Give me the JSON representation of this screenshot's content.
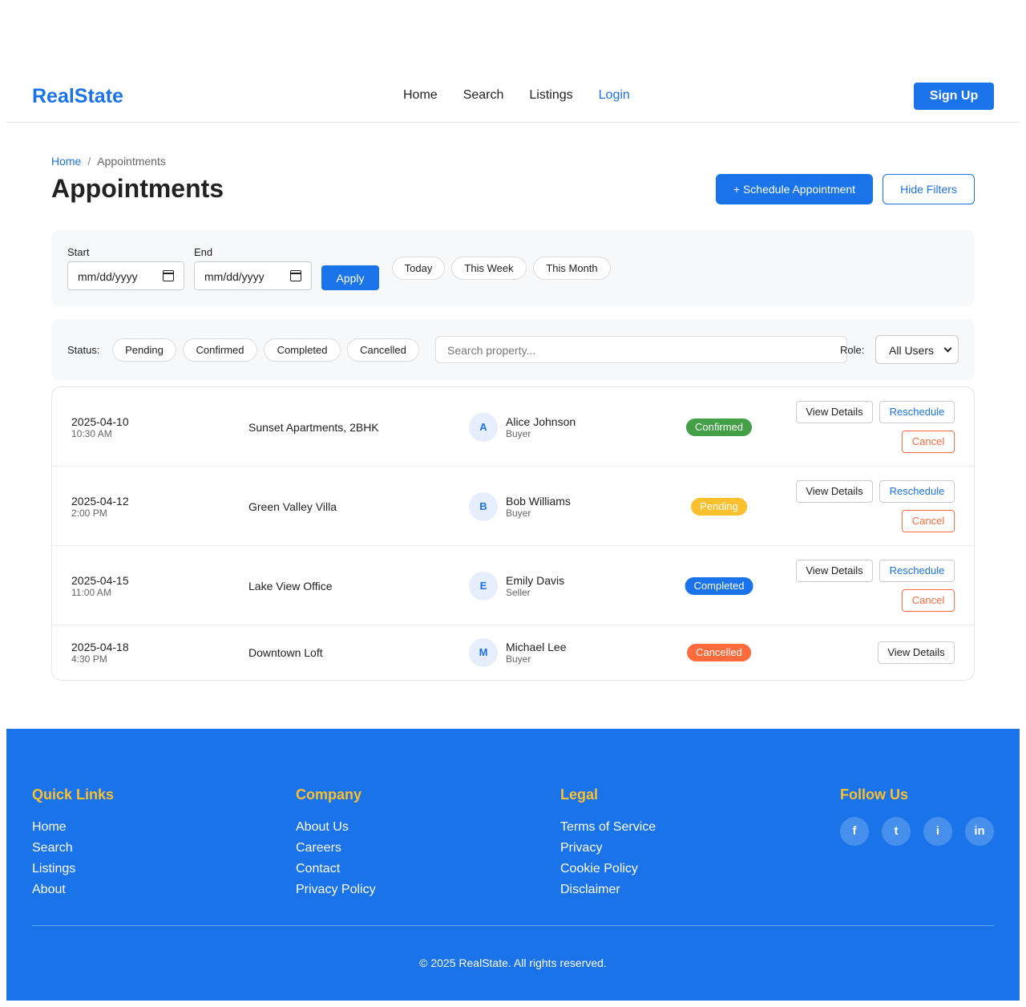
{
  "header": {
    "logo": "RealState",
    "nav": [
      {
        "label": "Home"
      },
      {
        "label": "Search"
      },
      {
        "label": "Listings"
      },
      {
        "label": "Login"
      }
    ],
    "signup_label": "Sign Up"
  },
  "breadcrumb": {
    "home": "Home",
    "separator": "/",
    "current": "Appointments"
  },
  "page": {
    "title": "Appointments",
    "schedule_label": "+ Schedule Appointment",
    "hide_filters_label": "Hide Filters"
  },
  "date_filter": {
    "start_label": "Start",
    "start_value": "mm/dd/yyyy",
    "end_label": "End",
    "end_value": "mm/dd/yyyy",
    "apply_label": "Apply",
    "quick_ranges": [
      "Today",
      "This Week",
      "This Month"
    ]
  },
  "status_filter": {
    "label": "Status:",
    "options": [
      "Pending",
      "Confirmed",
      "Completed",
      "Cancelled"
    ],
    "search_placeholder": "Search property...",
    "role_label": "Role:",
    "role_value": "All Users"
  },
  "appointments": [
    {
      "date": "2025-04-10",
      "time": "10:30 AM",
      "property": "Sunset Apartments, 2BHK",
      "initial": "A",
      "name": "Alice Johnson",
      "role": "Buyer",
      "status": "Confirmed",
      "actions": [
        "View Details",
        "Reschedule",
        "Cancel"
      ]
    },
    {
      "date": "2025-04-12",
      "time": "2:00 PM",
      "property": "Green Valley Villa",
      "initial": "B",
      "name": "Bob Williams",
      "role": "Buyer",
      "status": "Pending",
      "actions": [
        "View Details",
        "Reschedule",
        "Cancel"
      ]
    },
    {
      "date": "2025-04-15",
      "time": "11:00 AM",
      "property": "Lake View Office",
      "initial": "E",
      "name": "Emily Davis",
      "role": "Seller",
      "status": "Completed",
      "actions": [
        "View Details",
        "Reschedule",
        "Cancel"
      ]
    },
    {
      "date": "2025-04-18",
      "time": "4:30 PM",
      "property": "Downtown Loft",
      "initial": "M",
      "name": "Michael Lee",
      "role": "Buyer",
      "status": "Cancelled",
      "actions": [
        "View Details"
      ]
    }
  ],
  "footer": {
    "columns": [
      {
        "heading": "Quick Links",
        "links": [
          "Home",
          "Search",
          "Listings",
          "About"
        ]
      },
      {
        "heading": "Company",
        "links": [
          "About Us",
          "Careers",
          "Contact",
          "Privacy Policy"
        ]
      },
      {
        "heading": "Legal",
        "links": [
          "Terms of Service",
          "Privacy",
          "Cookie Policy",
          "Disclaimer"
        ]
      }
    ],
    "follow_heading": "Follow Us",
    "social": [
      {
        "glyph": "f",
        "icon": "facebook-icon"
      },
      {
        "glyph": "t",
        "icon": "twitter-icon"
      },
      {
        "glyph": "i",
        "icon": "instagram-icon"
      },
      {
        "glyph": "in",
        "icon": "linkedin-icon"
      }
    ],
    "copyright": "© 2025 RealState. All rights reserved."
  },
  "colors": {
    "primary": "#1a73e8",
    "accent_heading": "#fbc02d",
    "confirmed": "#43a047",
    "pending": "#fbc02d",
    "completed": "#1a73e8",
    "cancelled": "#ff6b3d"
  }
}
